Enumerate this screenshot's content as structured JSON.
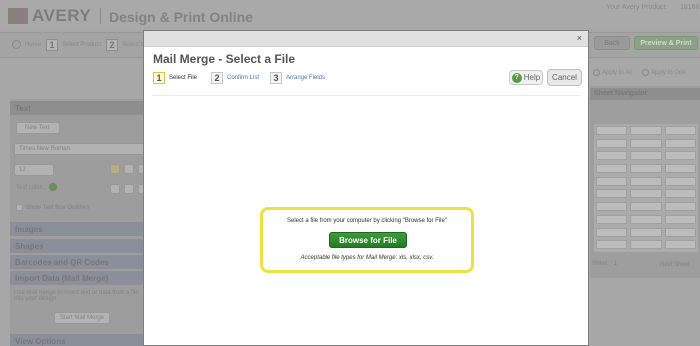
{
  "app": {
    "logo_text": "AVERY",
    "subtitle": "Design & Print Online",
    "your_product_label": "Your Avery Product:",
    "product_number": "18160"
  },
  "breadcrumb_steps": [
    {
      "label": "Home"
    },
    {
      "number": "1",
      "label": "Select Product"
    },
    {
      "number": "2",
      "label": "Select M"
    }
  ],
  "top_buttons": {
    "back": "Back",
    "preview": "Preview & Print"
  },
  "left_panel": {
    "text_header": "Text",
    "new_text_button": "New Text",
    "font_name": "Times New Roman",
    "font_size": "12",
    "text_color_label": "Text color:",
    "outline_label": "Show Text Box Outlines",
    "sections": [
      "Images",
      "Shapes",
      "Barcodes and QR Codes",
      "Import Data (Mail Merge)"
    ],
    "mail_merge_desc": "Use mail merge to insert text or data from a file into your design.",
    "start_mail_merge": "Start Mail Merge",
    "view_options": "View Options"
  },
  "right_panel": {
    "apply_all": "Apply to All",
    "apply_one": "Apply to One",
    "sheet_navigator": "Sheet Navigator",
    "sheet_label": "Sheet",
    "sheet_number": "1",
    "next_sheet": "Next Sheet"
  },
  "modal": {
    "close_label": "×",
    "title": "Mail Merge - Select a File",
    "steps": [
      {
        "number": "1",
        "label": "Select File"
      },
      {
        "number": "2",
        "label": "Confirm List"
      },
      {
        "number": "3",
        "label": "Arrange Fields"
      }
    ],
    "help_label": "Help",
    "help_icon_glyph": "?",
    "cancel_label": "Cancel",
    "instruction": "Select a file from your computer by clicking \"Browse for File\"",
    "browse_label": "Browse for File",
    "file_types": "Acceptable file types for Mail Merge: xls, xlsx, csv."
  },
  "colors": {
    "browse_green": "#2e8b2e",
    "highlight_yellow": "#efe141",
    "link_blue": "#4a78b1"
  }
}
